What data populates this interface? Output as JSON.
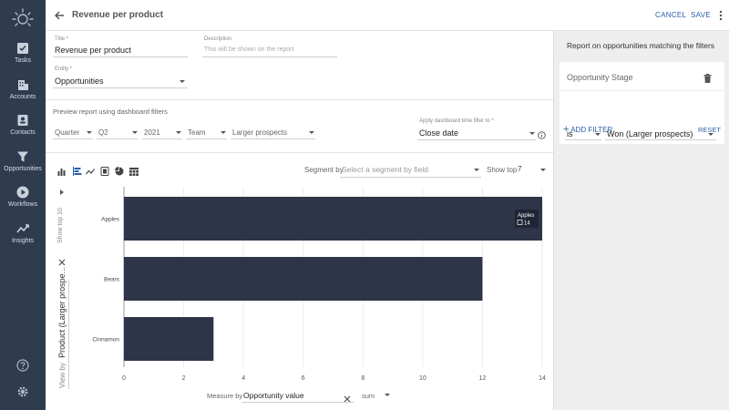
{
  "nav": {
    "items": [
      {
        "label": "Tasks",
        "icon": "check-square-icon"
      },
      {
        "label": "Accounts",
        "icon": "building-icon"
      },
      {
        "label": "Contacts",
        "icon": "contact-card-icon"
      },
      {
        "label": "Opportunities",
        "icon": "funnel-icon"
      },
      {
        "label": "Workflows",
        "icon": "play-circle-icon"
      },
      {
        "label": "Insights",
        "icon": "trend-line-icon"
      }
    ]
  },
  "header": {
    "title": "Revenue per product",
    "cancel": "CANCEL",
    "save": "SAVE"
  },
  "form": {
    "title_label": "Title",
    "title_value": "Revenue per product",
    "description_label": "Description",
    "description_placeholder": "This will be shown on the report",
    "entity_label": "Entity",
    "entity_value": "Opportunities",
    "preview_text": "Preview report using dashboard filters",
    "filters": {
      "period": "Quarter",
      "quarter": "Q2",
      "year": "2021",
      "team": "Team",
      "segment": "Larger prospects"
    },
    "time_filter_label": "Apply dashboard time filter to",
    "time_filter_value": "Close date"
  },
  "chart_controls": {
    "segment_label": "Segment by",
    "segment_placeholder": "Select a segment by field",
    "show_top_label": "Show top",
    "show_top_value": "7",
    "side_show_top": "Show top  10",
    "view_by_label": "View by",
    "view_by_value": "Product (Larger prospe...",
    "measure_label": "Measure by",
    "measure_value": "Opportunity value",
    "agg_value": "sum"
  },
  "chart_data": {
    "type": "bar",
    "orientation": "horizontal",
    "categories": [
      "Apples",
      "Bears",
      "Cinnamon"
    ],
    "values": [
      14,
      12,
      3
    ],
    "xlim": [
      0,
      14
    ],
    "xticks": [
      0,
      2,
      4,
      6,
      8,
      10,
      12,
      14
    ],
    "tooltip": {
      "label": "Apples",
      "value": "14"
    },
    "bar_color": "#2f3548"
  },
  "right_panel": {
    "title": "Report on opportunities matching the filters",
    "card_title": "Opportunity Stage",
    "operator": "is",
    "value": "Won (Larger prospects)",
    "add_filter": "ADD FILTER",
    "reset": "RESET"
  }
}
